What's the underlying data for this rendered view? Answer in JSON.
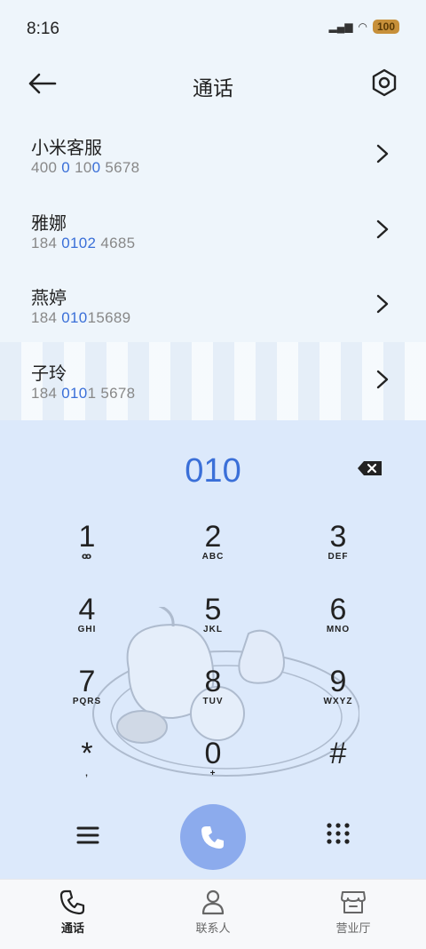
{
  "status_bar": {
    "time": "8:16",
    "battery": "100"
  },
  "header": {
    "title": "通话"
  },
  "contacts": [
    {
      "name": "小米客服",
      "num_pre": "400 ",
      "num_hl": "0",
      "num_mid": " 10",
      "num_hl2": "0",
      "num_post": " 5678"
    },
    {
      "name": "雅娜",
      "num_pre": "184 ",
      "num_hl": "0102",
      "num_mid": "",
      "num_hl2": "",
      "num_post": " 4685"
    },
    {
      "name": "燕婷",
      "num_pre": "184 ",
      "num_hl": "010",
      "num_mid": "",
      "num_hl2": "",
      "num_post": "15689"
    },
    {
      "name": "子玲",
      "num_pre": "184 ",
      "num_hl": "010",
      "num_mid": "",
      "num_hl2": "",
      "num_post": "1 5678"
    }
  ],
  "dial": {
    "input": "010"
  },
  "keys": [
    {
      "d": "1",
      "l": "ꝏ"
    },
    {
      "d": "2",
      "l": "ABC"
    },
    {
      "d": "3",
      "l": "DEF"
    },
    {
      "d": "4",
      "l": "GHI"
    },
    {
      "d": "5",
      "l": "JKL"
    },
    {
      "d": "6",
      "l": "MNO"
    },
    {
      "d": "7",
      "l": "PQRS"
    },
    {
      "d": "8",
      "l": "TUV"
    },
    {
      "d": "9",
      "l": "WXYZ"
    },
    {
      "d": "*",
      "l": ","
    },
    {
      "d": "0",
      "l": "+"
    },
    {
      "d": "#",
      "l": ""
    }
  ],
  "tabs": [
    {
      "label": "通话",
      "icon": "phone-icon"
    },
    {
      "label": "联系人",
      "icon": "person-icon"
    },
    {
      "label": "营业厅",
      "icon": "store-icon"
    }
  ],
  "colors": {
    "accent": "#3a6fd8",
    "call_button": "#8cabed",
    "dial_bg": "#dce9fb"
  }
}
